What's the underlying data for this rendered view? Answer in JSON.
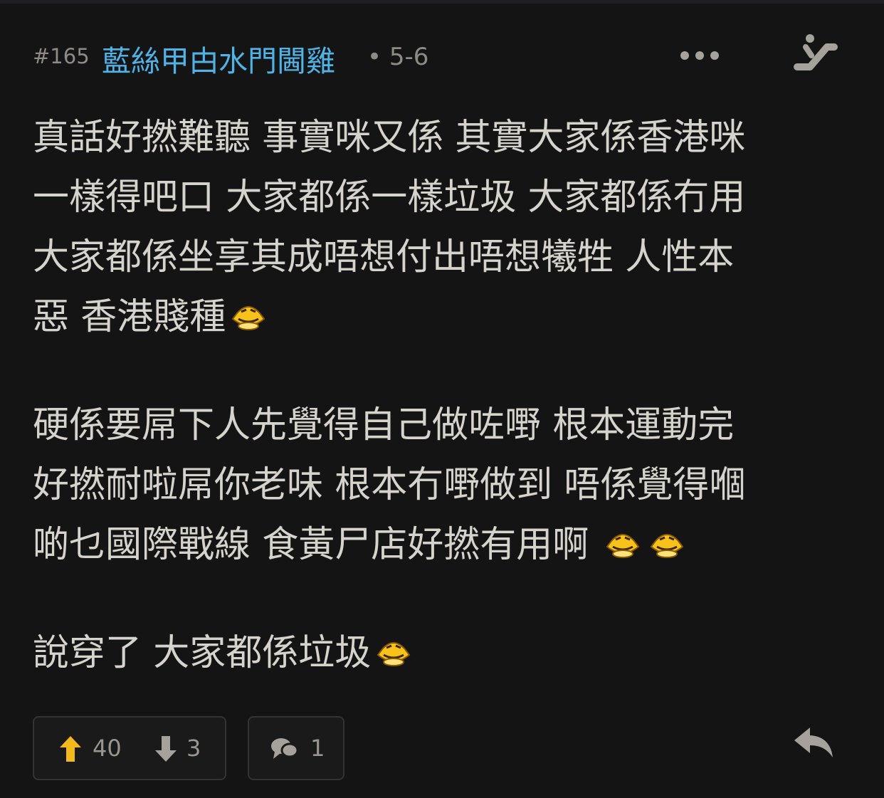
{
  "post": {
    "number": "#165",
    "username": "藍絲甲甴水門閪雞",
    "separator": "•",
    "date": "5-6"
  },
  "content": {
    "paragraph1": [
      "真話好撚難聽 事實咪又係 其實大家係香港咪",
      "一樣得吧口 大家都係一樣垃圾 大家都係冇用",
      "大家都係坐享其成唔想付出唔想犧牲 人性本",
      "惡 香港賤種"
    ],
    "paragraph2": [
      "硬係要屌下人先覺得自己做咗嘢 根本運動完",
      "好撚耐啦屌你老味 根本冇嘢做到 唔係覺得嗰",
      "啲乜國際戰線 食黃尸店好撚有用啊"
    ],
    "paragraph3": [
      "說穿了 大家都係垃圾"
    ]
  },
  "actions": {
    "upvotes": "40",
    "downvotes": "3",
    "comments": "1"
  },
  "colors": {
    "background": "#141414",
    "username": "#4fb3e8",
    "text": "#d6d2cc",
    "muted": "#8f8a84",
    "upvote": "#f2b81c"
  },
  "icons": [
    "more-icon",
    "escalator-icon",
    "laughing-emoji-icon",
    "upvote-icon",
    "downvote-icon",
    "comment-icon",
    "reply-icon"
  ]
}
